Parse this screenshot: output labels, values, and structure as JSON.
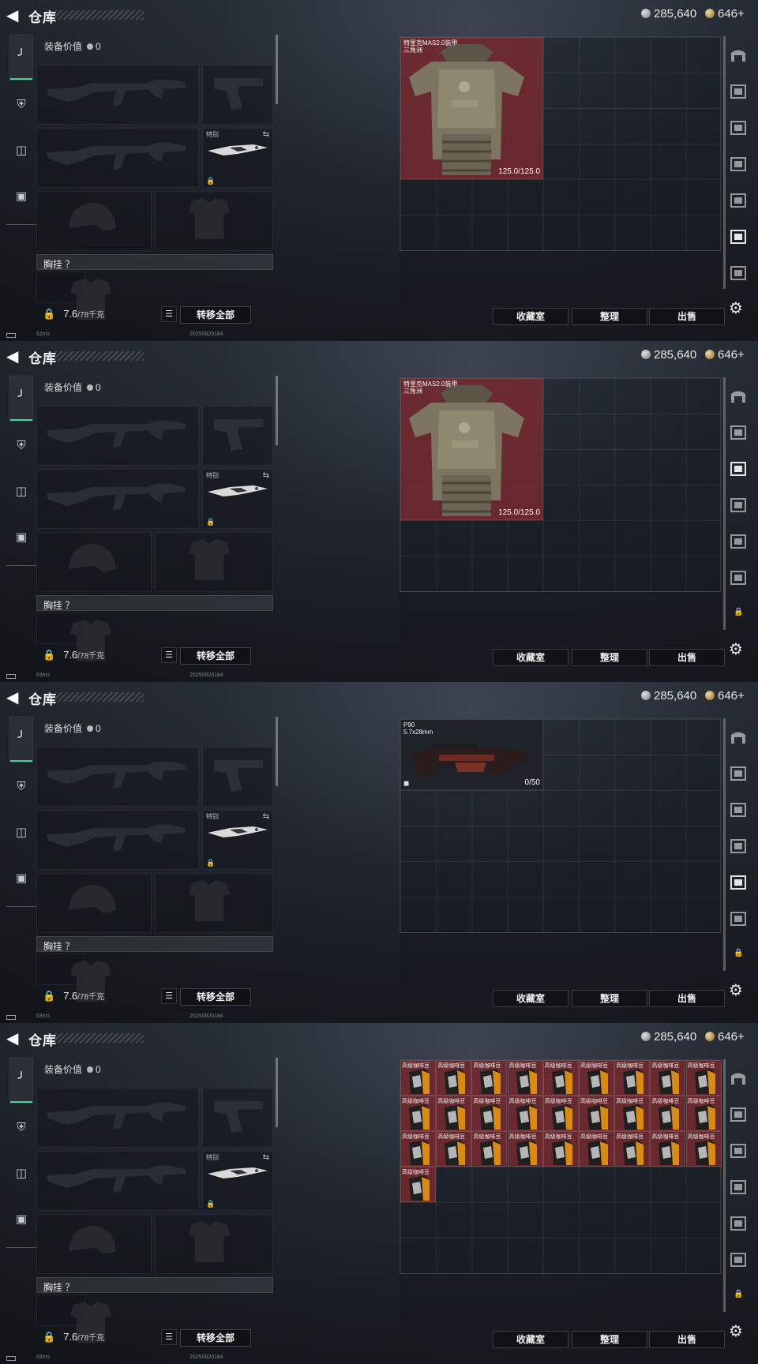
{
  "header": {
    "title": "仓库",
    "silver": "285,640",
    "gold": "646+"
  },
  "equipment": {
    "value_label": "装备价值",
    "value": "0",
    "knife_label": "特别",
    "chest_label": "胸挂 ？",
    "weight_value": "7.6",
    "weight_max": "/78千克",
    "transfer_all": "转移全部"
  },
  "buttons": {
    "collection": "收藏室",
    "sort": "整理",
    "sell": "出售"
  },
  "status": {
    "ping": [
      "62ms",
      "63ms",
      "63ms",
      "63ms"
    ],
    "build": "20250820184"
  },
  "panels": [
    {
      "item_name": "特里克MAS2.0装甲",
      "item_sub": "三角洲",
      "item_stat": "125.0/125.0",
      "active_tab": 6
    },
    {
      "item_name": "特里克MAS2.0装甲",
      "item_sub": "三角洲",
      "item_stat": "125.0/125.0",
      "active_tab": 3
    },
    {
      "item_name": "P90",
      "item_sub": "5.7x28mm",
      "item_stat": "0/50",
      "active_tab": 5
    },
    {
      "item_name": "高级咖啡豆",
      "item_count": 28,
      "active_tab": 7
    }
  ],
  "colors": {
    "accent": "#3ed49a",
    "item_bg": "#7e2a30"
  }
}
